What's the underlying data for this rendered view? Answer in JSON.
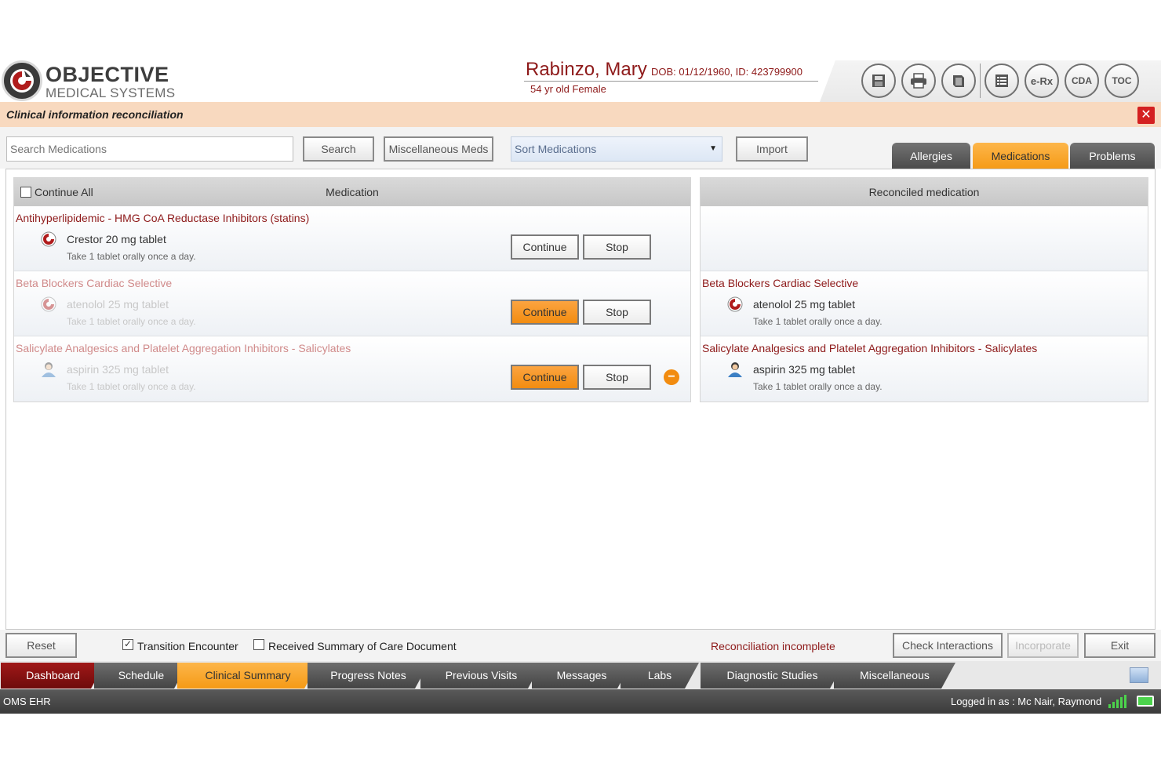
{
  "header": {
    "logo_title": "OBJECTIVE",
    "logo_subtitle": "MEDICAL SYSTEMS",
    "patient_name": "Rabinzo, Mary",
    "patient_dob_id": "DOB: 01/12/1960, ID: 423799900",
    "patient_age_gender": "54 yr old  Female",
    "icons": [
      {
        "name": "save-icon",
        "label": ""
      },
      {
        "name": "print-icon",
        "label": ""
      },
      {
        "name": "book-icon",
        "label": ""
      },
      {
        "name": "list-icon",
        "label": ""
      },
      {
        "name": "erx-icon",
        "label": "e-Rx"
      },
      {
        "name": "cda-icon",
        "label": "CDA"
      },
      {
        "name": "toc-icon",
        "label": "TOC"
      }
    ]
  },
  "titlebar": {
    "title": "Clinical information reconciliation",
    "close_label": "✕"
  },
  "toolbar": {
    "search_placeholder": "Search Medications",
    "search_label": "Search",
    "misc_meds_label": "Miscellaneous Meds",
    "sort_label": "Sort Medications",
    "import_label": "Import",
    "tabs": [
      {
        "label": "Allergies",
        "active": false
      },
      {
        "label": "Medications",
        "active": true
      },
      {
        "label": "Problems",
        "active": false
      }
    ]
  },
  "left_table": {
    "continue_all_label": "Continue All",
    "header": "Medication",
    "rows": [
      {
        "category": "Antihyperlipidemic - HMG CoA Reductase Inhibitors (statins)",
        "med": "Crestor 20 mg tablet",
        "sig": "Take 1 tablet orally once a day.",
        "continue": "Continue",
        "stop": "Stop",
        "state": "pending",
        "icon": "brand-icon"
      },
      {
        "category": "Beta Blockers Cardiac Selective",
        "med": "atenolol 25 mg tablet",
        "sig": "Take 1 tablet orally once a day.",
        "continue": "Continue",
        "stop": "Stop",
        "state": "continued",
        "icon": "brand-icon"
      },
      {
        "category": "Salicylate Analgesics and Platelet Aggregation Inhibitors - Salicylates",
        "med": "aspirin 325 mg tablet",
        "sig": "Take 1 tablet orally once a day.",
        "continue": "Continue",
        "stop": "Stop",
        "state": "continued",
        "icon": "person-icon"
      }
    ]
  },
  "right_table": {
    "header": "Reconciled medication",
    "rows": [
      {
        "category": "",
        "med": "",
        "sig": ""
      },
      {
        "category": "Beta Blockers Cardiac Selective",
        "med": "atenolol 25 mg tablet",
        "sig": "Take 1 tablet orally once a day.",
        "icon": "brand-icon"
      },
      {
        "category": "Salicylate Analgesics and Platelet Aggregation Inhibitors - Salicylates",
        "med": "aspirin 325 mg tablet",
        "sig": "Take 1 tablet orally once a day.",
        "icon": "person-icon"
      }
    ]
  },
  "footer": {
    "reset_label": "Reset",
    "transition_label": "Transition Encounter",
    "transition_checked": true,
    "received_label": "Received Summary of Care Document",
    "received_checked": false,
    "status": "Reconciliation incomplete",
    "check_label": "Check Interactions",
    "incorporate_label": "Incorporate",
    "exit_label": "Exit"
  },
  "nav": {
    "tabs": [
      "Dashboard",
      "Schedule",
      "Clinical Summary",
      "Progress Notes",
      "Previous Visits",
      "Messages",
      "Labs",
      "Diagnostic Studies",
      "Miscellaneous"
    ]
  },
  "statusbar": {
    "app_name": "OMS EHR",
    "logged_in": "Logged in as : Mc Nair, Raymond"
  },
  "colors": {
    "accent_orange": "#f59a16",
    "brand_red": "#8e1a1a",
    "title_bar": "#f8d9bf"
  }
}
